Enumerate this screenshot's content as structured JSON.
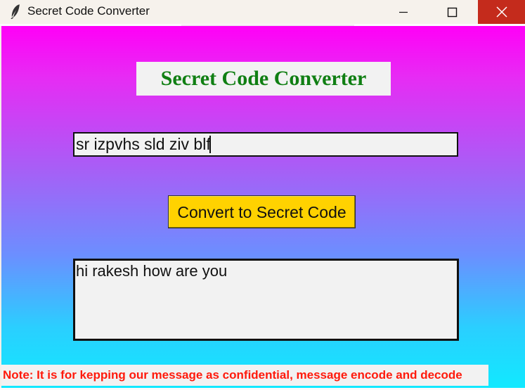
{
  "window": {
    "title": "Secret Code Converter",
    "icon": "feather-icon",
    "controls": [
      "minimize-icon",
      "maximize-icon",
      "close-icon"
    ]
  },
  "app": {
    "heading": "Secret Code Converter",
    "input": {
      "value": "sr izpvhs sld ziv blf"
    },
    "button": {
      "label": "Convert to Secret Code"
    },
    "output": {
      "value": "hi rakesh how are you"
    },
    "note": "Note: It is for kepping our message as confidential, message encode and decode"
  },
  "colors": {
    "title_bar": "#f6f2ec",
    "close_button": "#c42b1c",
    "gradient_top": "#ff00f7",
    "gradient_bottom": "#10eaff",
    "heading_text": "#107f13",
    "button": "#ffd200",
    "note_text": "#ff1a0c"
  }
}
